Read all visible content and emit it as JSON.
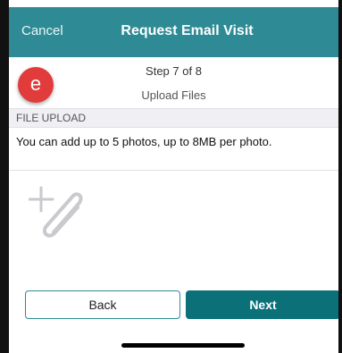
{
  "header": {
    "cancel_label": "Cancel",
    "title": "Request Email Visit"
  },
  "badge": {
    "letter": "e",
    "color": "#e23b3b"
  },
  "progress": {
    "step_text": "Step 7 of 8",
    "step_title": "Upload Files"
  },
  "section": {
    "title": "FILE UPLOAD",
    "hint": "You can add up to 5 photos, up to 8MB per photo."
  },
  "attach": {
    "icon": "add-attachment-icon"
  },
  "footer": {
    "back_label": "Back",
    "next_label": "Next"
  },
  "colors": {
    "header": "#2e8b95",
    "primary_button": "#0b7078",
    "section_bg": "#f0eff3"
  }
}
